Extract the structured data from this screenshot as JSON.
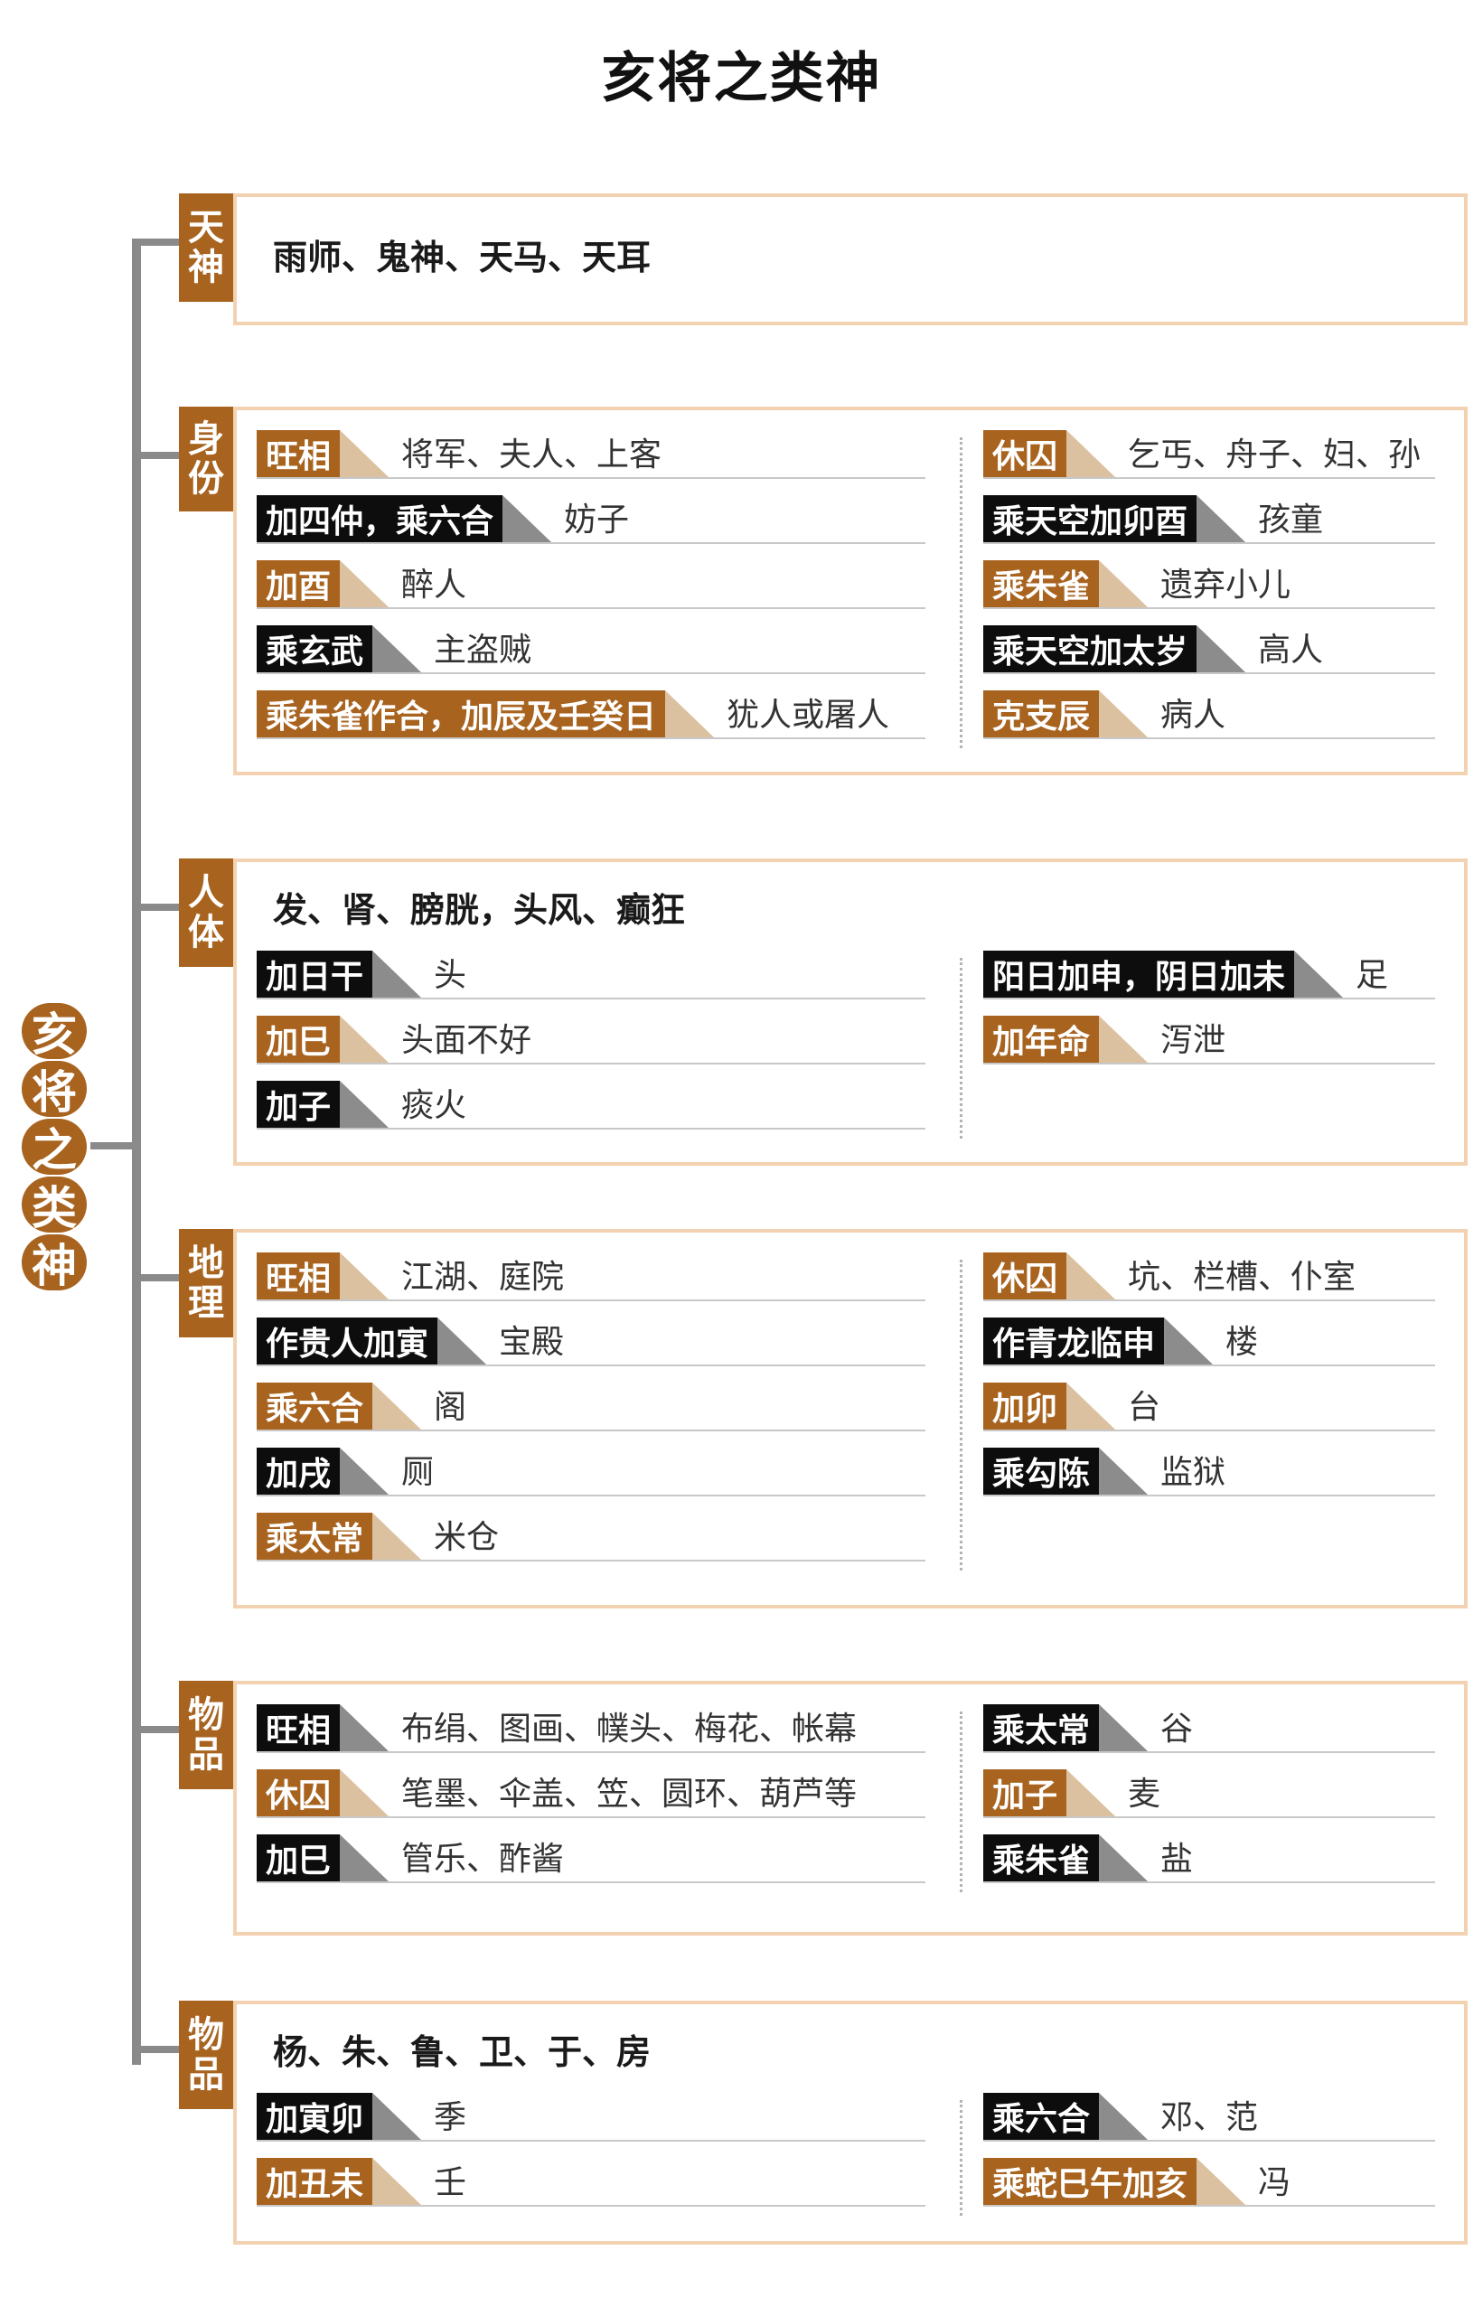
{
  "title": "亥将之类神",
  "root_label": [
    "亥",
    "将",
    "之",
    "类",
    "神"
  ],
  "colors": {
    "brown": "#a8631f",
    "black": "#0d0d0d",
    "tan_triangle": "#dcc1a0",
    "gray_triangle": "#8c8c8c",
    "panel_border": "#f2d2b0"
  },
  "sections": [
    {
      "tag": [
        "天",
        "神"
      ],
      "intro": "雨师、鬼神、天马、天耳",
      "left": [],
      "right": []
    },
    {
      "tag": [
        "身",
        "份"
      ],
      "intro": "",
      "left": [
        {
          "label": "旺相",
          "style": "brown",
          "value": "将军、夫人、上客"
        },
        {
          "label": "加四仲，乘六合",
          "style": "black",
          "value": "妨子"
        },
        {
          "label": "加酉",
          "style": "brown",
          "value": "醉人"
        },
        {
          "label": "乘玄武",
          "style": "black",
          "value": "主盗贼"
        },
        {
          "label": "乘朱雀作合，加辰及壬癸日",
          "style": "brown",
          "value": "犹人或屠人"
        }
      ],
      "right": [
        {
          "label": "休囚",
          "style": "brown",
          "value": "乞丐、舟子、妇、孙"
        },
        {
          "label": "乘天空加卯酉",
          "style": "black",
          "value": "孩童"
        },
        {
          "label": "乘朱雀",
          "style": "brown",
          "value": "遗弃小儿"
        },
        {
          "label": "乘天空加太岁",
          "style": "black",
          "value": "高人"
        },
        {
          "label": "克支辰",
          "style": "brown",
          "value": "病人"
        }
      ]
    },
    {
      "tag": [
        "人",
        "体"
      ],
      "intro": "发、肾、膀胱，头风、癫狂",
      "left": [
        {
          "label": "加日干",
          "style": "black",
          "value": "头"
        },
        {
          "label": "加巳",
          "style": "brown",
          "value": "头面不好"
        },
        {
          "label": "加子",
          "style": "black",
          "value": "痰火"
        }
      ],
      "right": [
        {
          "label": "阳日加申，阴日加未",
          "style": "black",
          "value": "足"
        },
        {
          "label": "加年命",
          "style": "brown",
          "value": "泻泄"
        }
      ]
    },
    {
      "tag": [
        "地",
        "理"
      ],
      "intro": "",
      "left": [
        {
          "label": "旺相",
          "style": "brown",
          "value": "江湖、庭院"
        },
        {
          "label": "作贵人加寅",
          "style": "black",
          "value": "宝殿"
        },
        {
          "label": "乘六合",
          "style": "brown",
          "value": "阁"
        },
        {
          "label": "加戌",
          "style": "black",
          "value": "厕"
        },
        {
          "label": "乘太常",
          "style": "brown",
          "value": "米仓"
        }
      ],
      "right": [
        {
          "label": "休囚",
          "style": "brown",
          "value": "坑、栏槽、仆室"
        },
        {
          "label": "作青龙临申",
          "style": "black",
          "value": "楼"
        },
        {
          "label": "加卯",
          "style": "brown",
          "value": "台"
        },
        {
          "label": "乘勾陈",
          "style": "black",
          "value": "监狱"
        }
      ]
    },
    {
      "tag": [
        "物",
        "品"
      ],
      "intro": "",
      "left": [
        {
          "label": "旺相",
          "style": "black",
          "value": "布绢、图画、幞头、梅花、帐幕"
        },
        {
          "label": "休囚",
          "style": "brown",
          "value": "笔墨、伞盖、笠、圆环、葫芦等"
        },
        {
          "label": "加巳",
          "style": "black",
          "value": "管乐、酢酱"
        }
      ],
      "right": [
        {
          "label": "乘太常",
          "style": "black",
          "value": "谷"
        },
        {
          "label": "加子",
          "style": "brown",
          "value": "麦"
        },
        {
          "label": "乘朱雀",
          "style": "black",
          "value": "盐"
        }
      ]
    },
    {
      "tag": [
        "物",
        "品"
      ],
      "intro": "杨、朱、鲁、卫、于、房",
      "left": [
        {
          "label": "加寅卯",
          "style": "black",
          "value": "季"
        },
        {
          "label": "加丑未",
          "style": "brown",
          "value": "壬"
        }
      ],
      "right": [
        {
          "label": "乘六合",
          "style": "black",
          "value": "邓、范"
        },
        {
          "label": "乘蛇巳午加亥",
          "style": "brown",
          "value": "冯"
        }
      ]
    }
  ]
}
